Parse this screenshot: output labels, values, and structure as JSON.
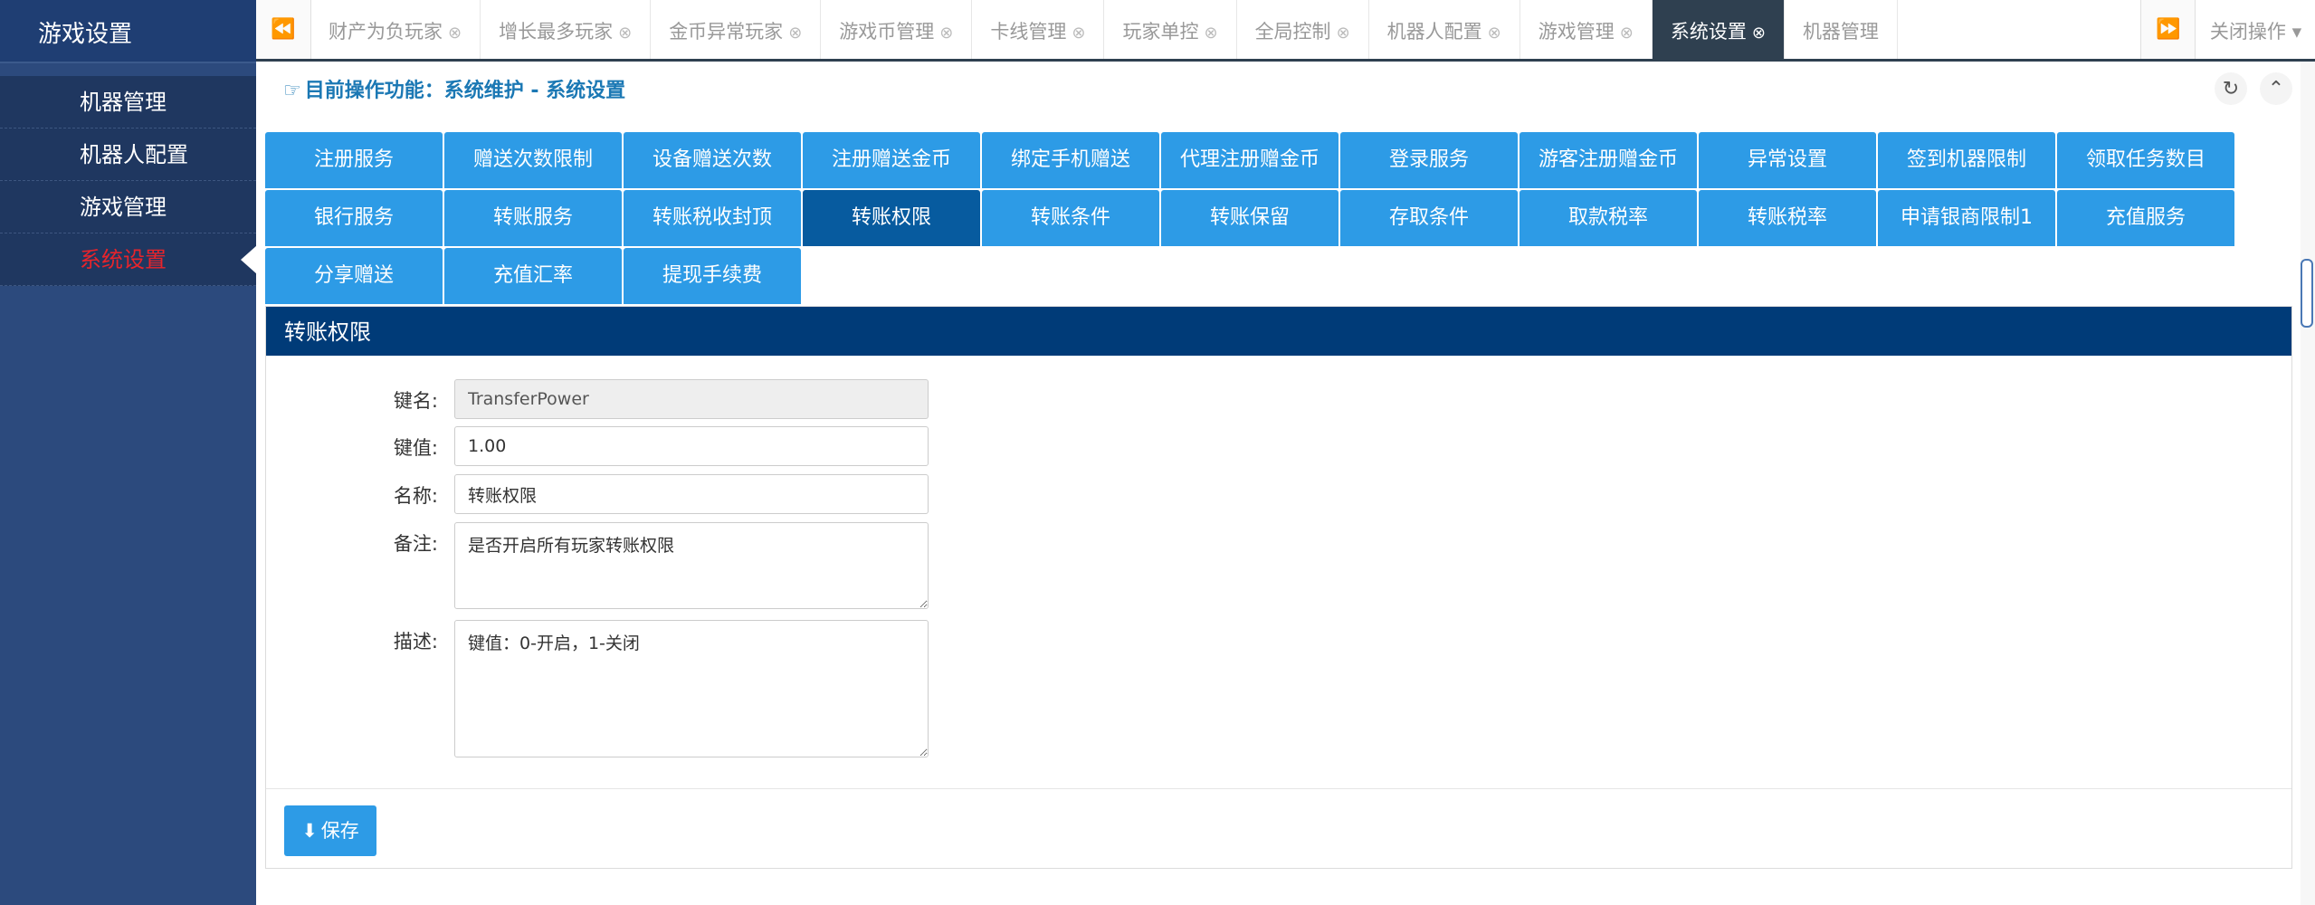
{
  "sidebar": {
    "title": "游戏设置",
    "items": [
      {
        "label": "机器管理"
      },
      {
        "label": "机器人配置"
      },
      {
        "label": "游戏管理"
      },
      {
        "label": "系统设置"
      }
    ]
  },
  "tabs": [
    {
      "label": "财产为负玩家"
    },
    {
      "label": "增长最多玩家"
    },
    {
      "label": "金币异常玩家"
    },
    {
      "label": "游戏币管理"
    },
    {
      "label": "卡线管理"
    },
    {
      "label": "玩家单控"
    },
    {
      "label": "全局控制"
    },
    {
      "label": "机器人配置"
    },
    {
      "label": "游戏管理"
    },
    {
      "label": "系统设置"
    },
    {
      "label": "机器管理"
    }
  ],
  "tabbar": {
    "close_ops": "关闭操作"
  },
  "breadcrumb": "目前操作功能：系统维护 - 系统设置",
  "config_buttons": [
    "注册服务",
    "赠送次数限制",
    "设备赠送次数",
    "注册赠送金币",
    "绑定手机赠送",
    "代理注册赠金币",
    "登录服务",
    "游客注册赠金币",
    "异常设置",
    "签到机器限制",
    "领取任务数目",
    "银行服务",
    "转账服务",
    "转账税收封顶",
    "转账权限",
    "转账条件",
    "转账保留",
    "存取条件",
    "取款税率",
    "转账税率",
    "申请银商限制1",
    "充值服务",
    "分享赠送",
    "充值汇率",
    "提现手续费"
  ],
  "panel": {
    "title": "转账权限",
    "fields": {
      "key_label": "键名:",
      "key_value": "TransferPower",
      "value_label": "键值:",
      "value_value": "1.00",
      "name_label": "名称:",
      "name_value": "转账权限",
      "remark_label": "备注:",
      "remark_value": "是否开启所有玩家转账权限",
      "desc_label": "描述:",
      "desc_value": "键值：0-开启，1-关闭"
    },
    "save_label": "保存"
  },
  "colors": {
    "sidebar_bg": "#2c4a7d",
    "button_blue": "#2d9be6",
    "button_active": "#075b9f",
    "panel_header": "#003b78",
    "active_menu": "#e8242b"
  }
}
